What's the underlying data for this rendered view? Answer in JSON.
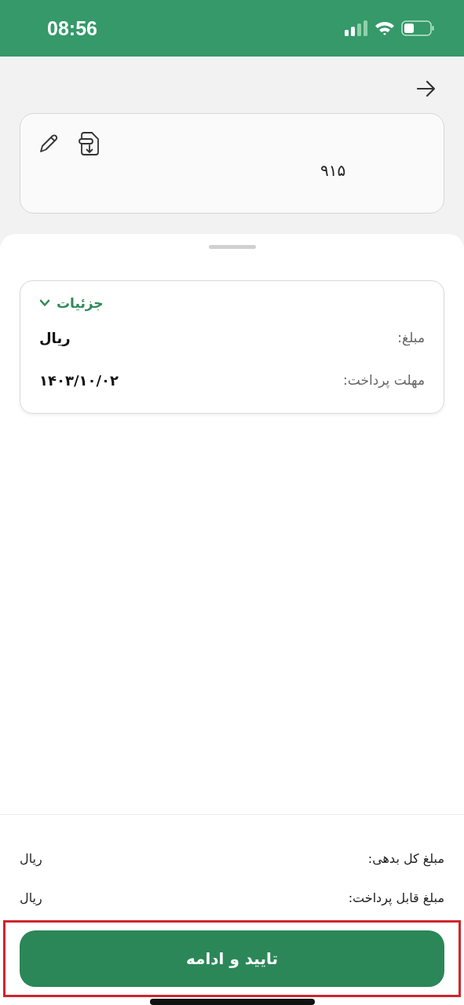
{
  "status_bar": {
    "time": "08:56"
  },
  "bill_card": {
    "number": "۹۱۵"
  },
  "details": {
    "title": "جزئیات",
    "expanded": true,
    "rows": [
      {
        "label": "مبلغ:",
        "value": "ریال"
      },
      {
        "label": "مهلت پرداخت:",
        "value": "۱۴۰۳/۱۰/۰۲"
      }
    ]
  },
  "summary": [
    {
      "label": "مبلغ کل بدهی:",
      "value": "ریال"
    },
    {
      "label": "مبلغ قابل پرداخت:",
      "value": "ریال"
    }
  ],
  "confirm_button": {
    "label": "تایید و ادامه"
  }
}
